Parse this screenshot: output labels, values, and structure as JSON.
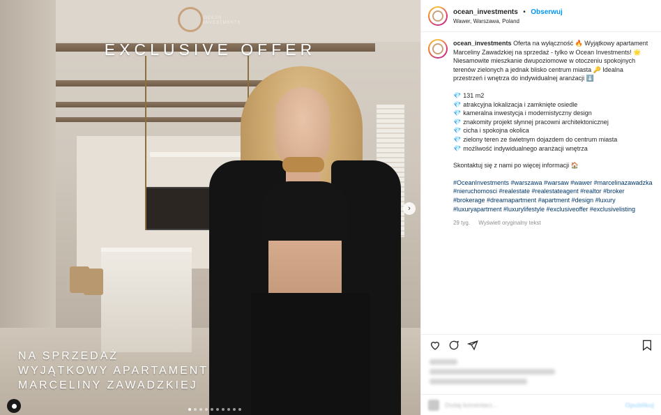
{
  "media": {
    "brand_small": "OCEAN\nINVESTMENTS",
    "headline": "EXCLUSIVE OFFER",
    "overlay_lines": [
      "NA SPRZEDAŻ",
      "WYJĄTKOWY APARTAMENT",
      "MARCELINY ZAWADZKIEJ"
    ],
    "carousel_count": 10,
    "carousel_active": 0
  },
  "header": {
    "username": "ocean_investments",
    "separator": "•",
    "follow_label": "Obserwuj",
    "location": "Wawer, Warszawa, Poland"
  },
  "caption": {
    "username": "ocean_investments",
    "intro": "Oferta na wyłączność 🔥 Wyjątkowy apartament Marceliny Zawadzkiej na sprzedaż - tylko w Ocean Investments! 🌟 Niesamowite mieszkanie dwupoziomowe w otoczeniu spokojnych terenów zielonych a jednak blisko centrum miasta 🔑 Idealna przestrzeń i wnętrza do indywidualnej aranżacji ⬇️",
    "features": [
      "131 m2",
      "atrakcyjna lokalizacja i zamknięte osiedle",
      "kameralna inwestycja i modernistyczny design",
      "znakomity projekt słynnej pracowni architektonicznej",
      "cicha i spokojna okolica",
      "zielony teren ze świetnym dojazdem do centrum miasta",
      "możliwość indywidualnego aranżacji wnętrza"
    ],
    "feature_icon": "💎",
    "contact": "Skontaktuj się z nami po więcej informacji 🏠",
    "hashtags": "#OceanInvestments #warszawa #warsaw #wawer #marcelinazawadzka #nieruchomosci #realestate #realestateagent #realtor #broker #brokerage #dreamapartment #apartment #design #luxury #luxuryapartment #luxurylifestyle #exclusiveoffer #exclusivelisting",
    "time_ago": "29 tyg.",
    "see_original": "Wyświetl oryginalny tekst"
  },
  "comment_bar": {
    "placeholder": "Dodaj komentarz...",
    "publish_label": "Opublikuj"
  },
  "colors": {
    "link_blue": "#0095f6",
    "hashtag": "#00376b",
    "brand_gold": "#c8a27a"
  },
  "icons": {
    "like": "heart-icon",
    "comment": "comment-icon",
    "share": "share-icon",
    "save": "bookmark-icon",
    "next": "chevron-right-icon",
    "tag": "user-tag-icon"
  }
}
